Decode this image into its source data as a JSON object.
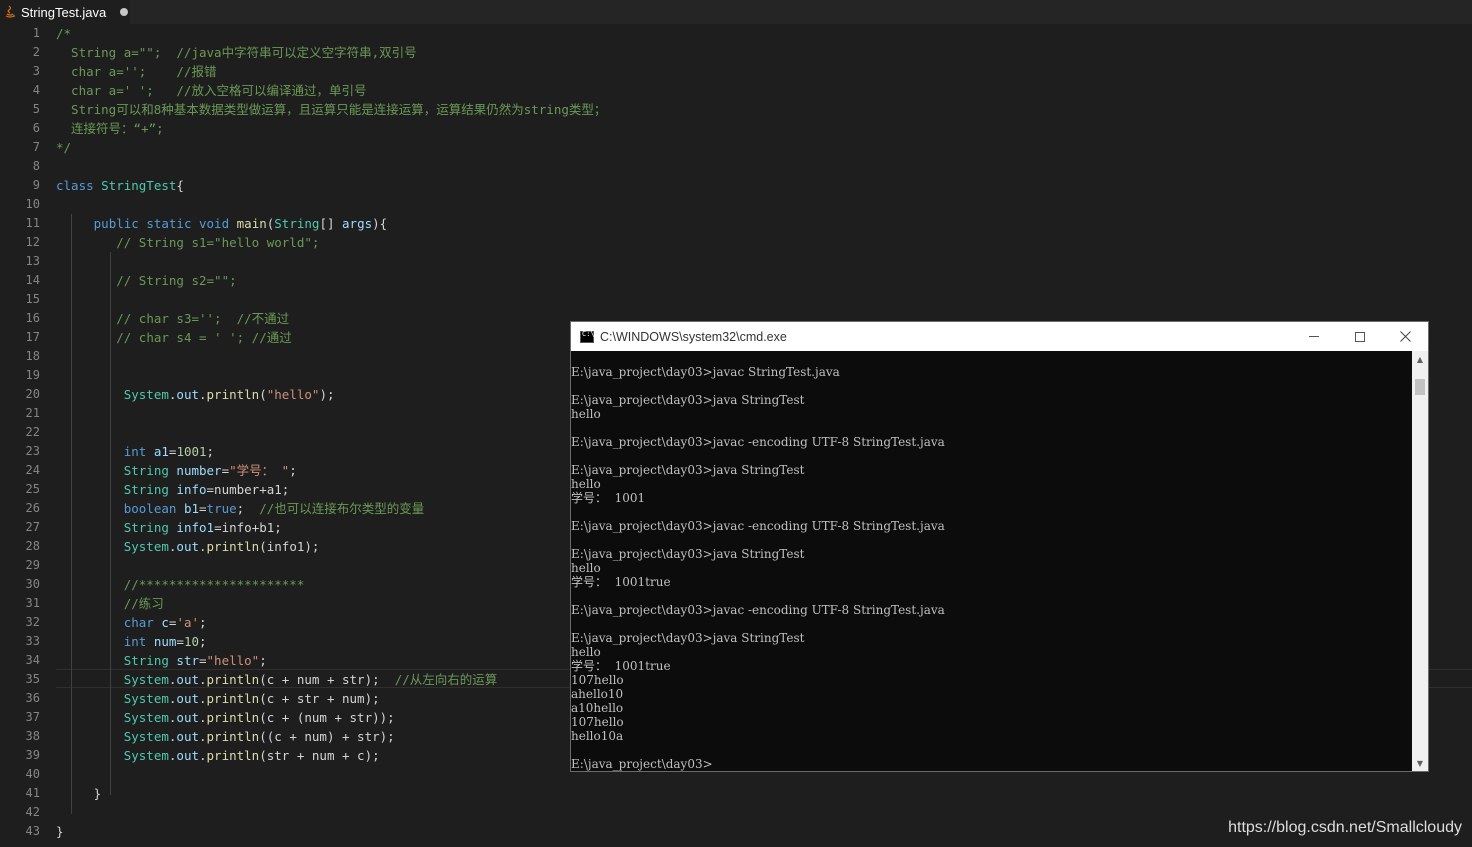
{
  "tab": {
    "filename": "StringTest.java"
  },
  "editor": {
    "line_numbers": [
      "1",
      "2",
      "3",
      "4",
      "5",
      "6",
      "7",
      "8",
      "9",
      "10",
      "11",
      "12",
      "13",
      "14",
      "15",
      "16",
      "17",
      "18",
      "19",
      "20",
      "21",
      "22",
      "23",
      "24",
      "25",
      "26",
      "27",
      "28",
      "29",
      "30",
      "31",
      "32",
      "33",
      "34",
      "35",
      "36",
      "37",
      "38",
      "39",
      "40",
      "41",
      "42",
      "43"
    ],
    "lines": [
      [
        [
          "cm",
          "/*"
        ]
      ],
      [
        [
          "cm",
          "  String a=\"\";  //java中字符串可以定义空字符串,双引号"
        ]
      ],
      [
        [
          "cm",
          "  char a='';    //报错"
        ]
      ],
      [
        [
          "cm",
          "  char a=' ';   //放入空格可以编译通过，单引号"
        ]
      ],
      [
        [
          "cm",
          "  String可以和8种基本数据类型做运算，且运算只能是连接运算，运算结果仍然为string类型；"
        ]
      ],
      [
        [
          "cm",
          "  连接符号：“+”;"
        ]
      ],
      [
        [
          "cm",
          "*/"
        ]
      ],
      [],
      [
        [
          "kw",
          "class "
        ],
        [
          "ty",
          "StringTest"
        ],
        [
          "pl",
          "{"
        ]
      ],
      [],
      [
        [
          "pl",
          "     "
        ],
        [
          "kw",
          "public static void "
        ],
        [
          "fn",
          "main"
        ],
        [
          "pl",
          "("
        ],
        [
          "ty",
          "String"
        ],
        [
          "pl",
          "[] "
        ],
        [
          "va",
          "args"
        ],
        [
          "pl",
          "){"
        ]
      ],
      [
        [
          "pl",
          "        "
        ],
        [
          "cm",
          "// String s1=\"hello world\";"
        ]
      ],
      [],
      [
        [
          "pl",
          "        "
        ],
        [
          "cm",
          "// String s2=\"\";"
        ]
      ],
      [],
      [
        [
          "pl",
          "        "
        ],
        [
          "cm",
          "// char s3='';  //不通过"
        ]
      ],
      [
        [
          "pl",
          "        "
        ],
        [
          "cm",
          "// char s4 = ' '; //通过"
        ]
      ],
      [],
      [],
      [
        [
          "pl",
          "         "
        ],
        [
          "ty",
          "System"
        ],
        [
          "pl",
          "."
        ],
        [
          "va",
          "out"
        ],
        [
          "pl",
          "."
        ],
        [
          "fn",
          "println"
        ],
        [
          "pl",
          "("
        ],
        [
          "st",
          "\"hello\""
        ],
        [
          "pl",
          ");"
        ]
      ],
      [],
      [],
      [
        [
          "pl",
          "         "
        ],
        [
          "kw",
          "int "
        ],
        [
          "va",
          "a1"
        ],
        [
          "pl",
          "="
        ],
        [
          "nu",
          "1001"
        ],
        [
          "pl",
          ";"
        ]
      ],
      [
        [
          "pl",
          "         "
        ],
        [
          "ty",
          "String "
        ],
        [
          "va",
          "number"
        ],
        [
          "pl",
          "="
        ],
        [
          "st",
          "\"学号： \""
        ],
        [
          "pl",
          ";"
        ]
      ],
      [
        [
          "pl",
          "         "
        ],
        [
          "ty",
          "String "
        ],
        [
          "va",
          "info"
        ],
        [
          "pl",
          "=number+a1;"
        ]
      ],
      [
        [
          "pl",
          "         "
        ],
        [
          "kw",
          "boolean "
        ],
        [
          "va",
          "b1"
        ],
        [
          "pl",
          "="
        ],
        [
          "kw",
          "true"
        ],
        [
          "pl",
          ";  "
        ],
        [
          "cm",
          "//也可以连接布尔类型的变量"
        ]
      ],
      [
        [
          "pl",
          "         "
        ],
        [
          "ty",
          "String "
        ],
        [
          "va",
          "info1"
        ],
        [
          "pl",
          "=info+b1;"
        ]
      ],
      [
        [
          "pl",
          "         "
        ],
        [
          "ty",
          "System"
        ],
        [
          "pl",
          "."
        ],
        [
          "va",
          "out"
        ],
        [
          "pl",
          "."
        ],
        [
          "fn",
          "println"
        ],
        [
          "pl",
          "(info1);"
        ]
      ],
      [],
      [
        [
          "pl",
          "         "
        ],
        [
          "cm",
          "//**********************"
        ]
      ],
      [
        [
          "pl",
          "         "
        ],
        [
          "cm",
          "//练习"
        ]
      ],
      [
        [
          "pl",
          "         "
        ],
        [
          "kw",
          "char "
        ],
        [
          "va",
          "c"
        ],
        [
          "pl",
          "="
        ],
        [
          "st",
          "'a'"
        ],
        [
          "pl",
          ";"
        ]
      ],
      [
        [
          "pl",
          "         "
        ],
        [
          "kw",
          "int "
        ],
        [
          "va",
          "num"
        ],
        [
          "pl",
          "="
        ],
        [
          "nu",
          "10"
        ],
        [
          "pl",
          ";"
        ]
      ],
      [
        [
          "pl",
          "         "
        ],
        [
          "ty",
          "String "
        ],
        [
          "va",
          "str"
        ],
        [
          "pl",
          "="
        ],
        [
          "st",
          "\"hello\""
        ],
        [
          "pl",
          ";"
        ]
      ],
      [
        [
          "pl",
          "         "
        ],
        [
          "ty",
          "System"
        ],
        [
          "pl",
          "."
        ],
        [
          "va",
          "out"
        ],
        [
          "pl",
          "."
        ],
        [
          "fn",
          "println"
        ],
        [
          "pl",
          "(c + num + str);  "
        ],
        [
          "cm",
          "//从左向右的运算"
        ]
      ],
      [
        [
          "pl",
          "         "
        ],
        [
          "ty",
          "System"
        ],
        [
          "pl",
          "."
        ],
        [
          "va",
          "out"
        ],
        [
          "pl",
          "."
        ],
        [
          "fn",
          "println"
        ],
        [
          "pl",
          "(c + str + num);"
        ]
      ],
      [
        [
          "pl",
          "         "
        ],
        [
          "ty",
          "System"
        ],
        [
          "pl",
          "."
        ],
        [
          "va",
          "out"
        ],
        [
          "pl",
          "."
        ],
        [
          "fn",
          "println"
        ],
        [
          "pl",
          "(c + (num + str));"
        ]
      ],
      [
        [
          "pl",
          "         "
        ],
        [
          "ty",
          "System"
        ],
        [
          "pl",
          "."
        ],
        [
          "va",
          "out"
        ],
        [
          "pl",
          "."
        ],
        [
          "fn",
          "println"
        ],
        [
          "pl",
          "((c + num) + str);"
        ]
      ],
      [
        [
          "pl",
          "         "
        ],
        [
          "ty",
          "System"
        ],
        [
          "pl",
          "."
        ],
        [
          "va",
          "out"
        ],
        [
          "pl",
          "."
        ],
        [
          "fn",
          "println"
        ],
        [
          "pl",
          "(str + num + c);"
        ]
      ],
      [],
      [
        [
          "pl",
          "     }"
        ]
      ],
      [],
      [
        [
          "pl",
          "}"
        ]
      ]
    ]
  },
  "cmd": {
    "title": "C:\\WINDOWS\\system32\\cmd.exe",
    "output": [
      "",
      "E:\\java_project\\day03>javac StringTest.java",
      "",
      "E:\\java_project\\day03>java StringTest",
      "hello",
      "",
      "E:\\java_project\\day03>javac -encoding UTF-8 StringTest.java",
      "",
      "E:\\java_project\\day03>java StringTest",
      "hello",
      "学号：  1001",
      "",
      "E:\\java_project\\day03>javac -encoding UTF-8 StringTest.java",
      "",
      "E:\\java_project\\day03>java StringTest",
      "hello",
      "学号：  1001true",
      "",
      "E:\\java_project\\day03>javac -encoding UTF-8 StringTest.java",
      "",
      "E:\\java_project\\day03>java StringTest",
      "hello",
      "学号：  1001true",
      "107hello",
      "ahello10",
      "a10hello",
      "107hello",
      "hello10a",
      "",
      "E:\\java_project\\day03>"
    ]
  },
  "watermark": "https://blog.csdn.net/Smallcloudy",
  "colors": {
    "editor_bg": "#1e1e1e",
    "comment": "#6a9955",
    "keyword": "#569cd6",
    "type": "#4ec9b0",
    "function": "#dcdcaa",
    "string": "#ce9178",
    "number": "#b5cea8",
    "variable": "#9cdcfe",
    "cmd_bg": "#0c0c0c",
    "cmd_text": "#c0c0c0"
  }
}
